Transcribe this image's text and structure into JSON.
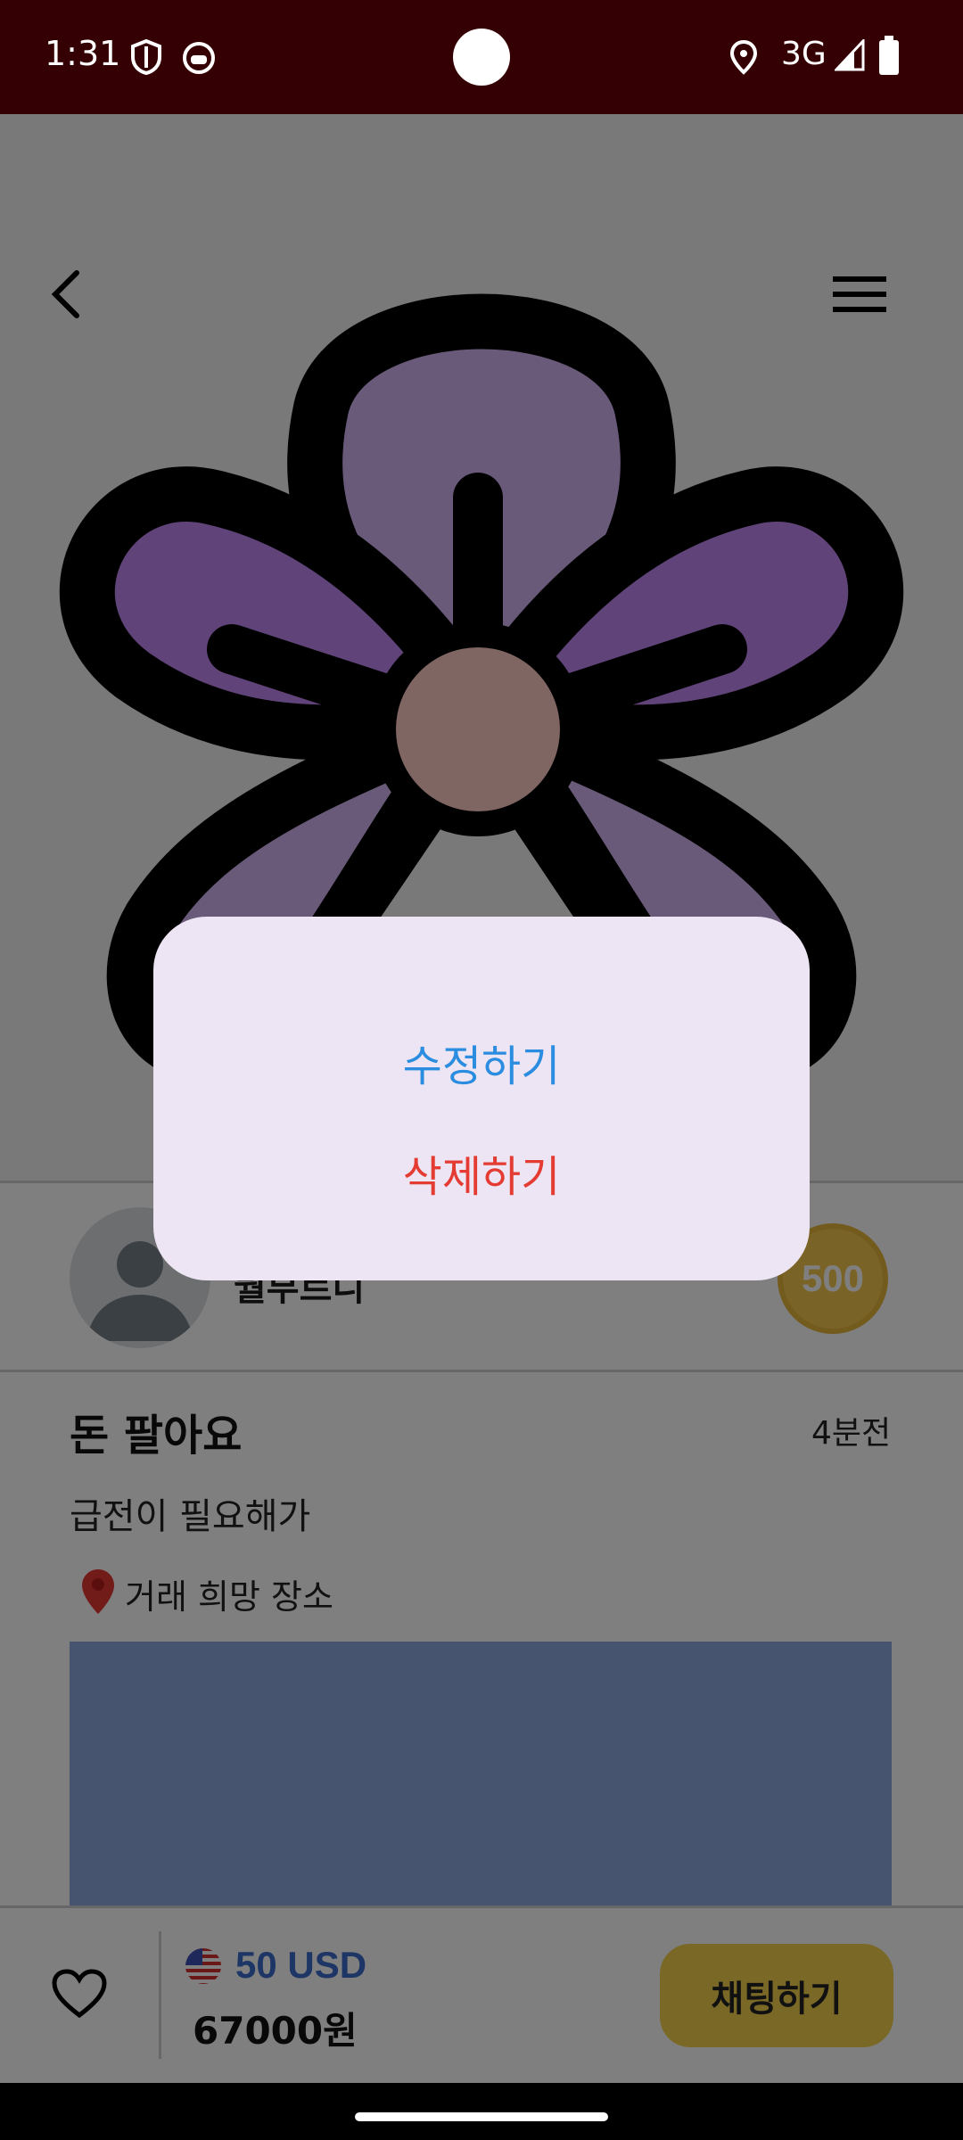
{
  "status_bar": {
    "time": "1:31",
    "network": "3G",
    "icons": [
      "shield-icon",
      "cat-icon",
      "location-icon",
      "signal-icon",
      "battery-icon"
    ]
  },
  "top_nav": {
    "back_icon": "chevron-left-icon",
    "menu_icon": "hamburger-menu-icon"
  },
  "hero": {
    "image": "flower-icon"
  },
  "seller": {
    "name": "뭘부르니",
    "badge": "500"
  },
  "post": {
    "title": "돈 팔아요",
    "time_ago": "4분전",
    "body": "급전이 필요해가",
    "place_label": "거래 희망 장소"
  },
  "price": {
    "usd": "50 USD",
    "krw": "67000원"
  },
  "bottom": {
    "chat_label": "채팅하기"
  },
  "dialog": {
    "edit_label": "수정하기",
    "delete_label": "삭제하기"
  },
  "colors": {
    "status_bar": "#350003",
    "chat_button": "#f4d04c",
    "edit_text": "#2b8de0",
    "delete_text": "#e43b32",
    "dialog_bg": "#ede5f3",
    "usd_text": "#3d6ccc"
  }
}
